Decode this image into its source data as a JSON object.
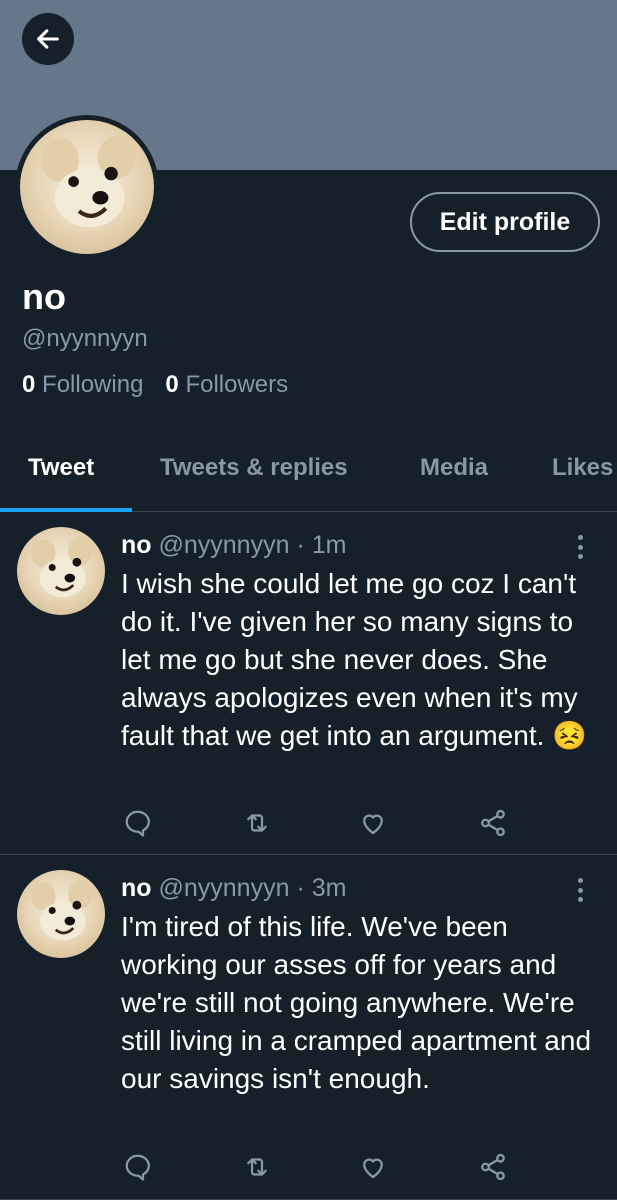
{
  "profile": {
    "name": "no",
    "handle": "@nyynnyyn",
    "following_count": "0",
    "following_label": "Following",
    "followers_count": "0",
    "followers_label": "Followers",
    "edit_label": "Edit profile"
  },
  "tabs": [
    "Tweet",
    "Tweets & replies",
    "Media",
    "Likes"
  ],
  "active_tab": "Tweet",
  "tweets": [
    {
      "name": "no",
      "handle": "@nyynnyyn",
      "time": "· 1m",
      "text": "I wish she could let me go coz I can't do it. I've given her so many signs to let me go but she never does. She always apologizes even when it's my fault that we get into an argument. 😣"
    },
    {
      "name": "no",
      "handle": "@nyynnyyn",
      "time": "· 3m",
      "text": "I'm tired of this life. We've been working our asses off for years and we're still not going anywhere. We're still living in a cramped apartment and our savings isn't enough."
    }
  ],
  "colors": {
    "background": "#15202b",
    "banner": "#66778a",
    "secondary_text": "#8899a6",
    "accent": "#1da1f2",
    "divider": "#38444d"
  },
  "icons": [
    "back-arrow-icon",
    "reply-icon",
    "retweet-icon",
    "like-icon",
    "share-icon",
    "more-icon"
  ]
}
